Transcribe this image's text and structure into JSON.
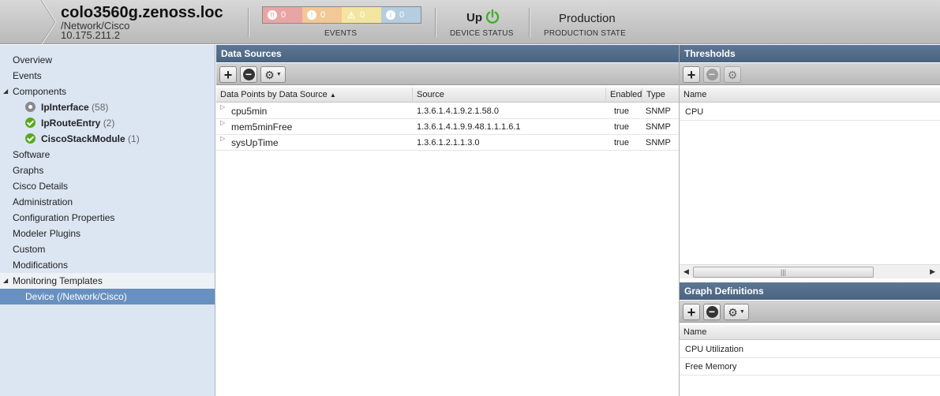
{
  "header": {
    "device_name": "colo3560g.zenoss.loc",
    "device_class": "/Network/Cisco",
    "ip": "10.175.211.2",
    "events": {
      "critical": "0",
      "error": "0",
      "warning": "0",
      "info": "0",
      "label": "EVENTS"
    },
    "device_status": {
      "value": "Up",
      "label": "DEVICE STATUS"
    },
    "production_state": {
      "value": "Production",
      "label": "PRODUCTION STATE"
    }
  },
  "leftnav": {
    "overview": "Overview",
    "events": "Events",
    "components": "Components",
    "component_items": [
      {
        "name": "IpInterface",
        "count": "(58)"
      },
      {
        "name": "IpRouteEntry",
        "count": "(2)"
      },
      {
        "name": "CiscoStackModule",
        "count": "(1)"
      }
    ],
    "software": "Software",
    "graphs": "Graphs",
    "cisco_details": "Cisco Details",
    "administration": "Administration",
    "configuration_properties": "Configuration Properties",
    "modeler_plugins": "Modeler Plugins",
    "custom": "Custom",
    "modifications": "Modifications",
    "monitoring_templates": "Monitoring Templates",
    "template_item": "Device (/Network/Cisco)"
  },
  "datasources": {
    "title": "Data Sources",
    "columns": {
      "datapoints": "Data Points by Data Source",
      "source": "Source",
      "enabled": "Enabled",
      "type": "Type"
    },
    "rows": [
      {
        "name": "cpu5min",
        "source": "1.3.6.1.4.1.9.2.1.58.0",
        "enabled": "true",
        "type": "SNMP"
      },
      {
        "name": "mem5minFree",
        "source": "1.3.6.1.4.1.9.9.48.1.1.1.6.1",
        "enabled": "true",
        "type": "SNMP"
      },
      {
        "name": "sysUpTime",
        "source": "1.3.6.1.2.1.1.3.0",
        "enabled": "true",
        "type": "SNMP"
      }
    ]
  },
  "thresholds": {
    "title": "Thresholds",
    "column_name": "Name",
    "rows": [
      "CPU"
    ]
  },
  "graph_definitions": {
    "title": "Graph Definitions",
    "column_name": "Name",
    "rows": [
      "CPU Utilization",
      "Free Memory"
    ]
  },
  "colors": {
    "panel_header": "#4a6381",
    "nav_background": "#dbe6f2",
    "nav_selected": "#6890c0",
    "status_ok": "#5aa820"
  }
}
